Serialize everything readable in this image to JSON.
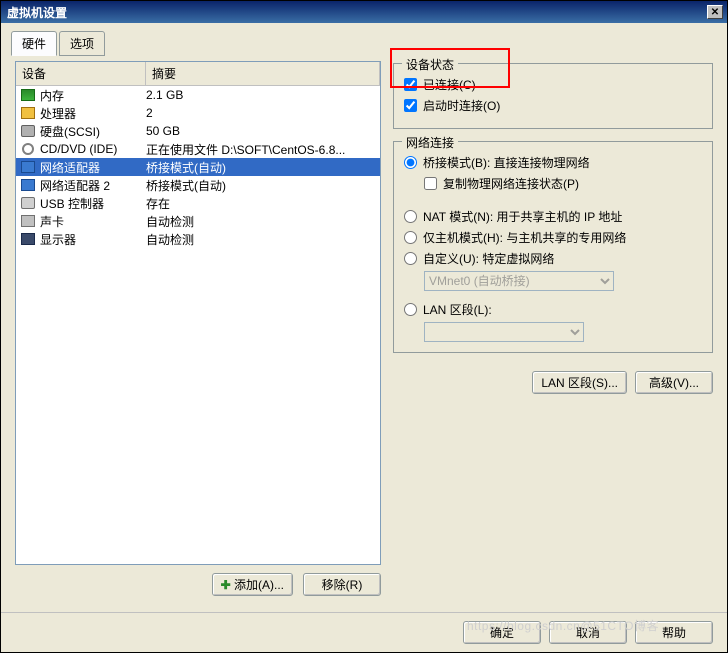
{
  "title": "虚拟机设置",
  "tabs": {
    "hardware": "硬件",
    "options": "选项"
  },
  "columns": {
    "device": "设备",
    "summary": "摘要"
  },
  "devices": [
    {
      "name": "内存",
      "summary": "2.1 GB",
      "icon": "mem"
    },
    {
      "name": "处理器",
      "summary": "2",
      "icon": "cpu"
    },
    {
      "name": "硬盘(SCSI)",
      "summary": "50 GB",
      "icon": "hdd"
    },
    {
      "name": "CD/DVD (IDE)",
      "summary": "正在使用文件 D:\\SOFT\\CentOS-6.8...",
      "icon": "cd"
    },
    {
      "name": "网络适配器",
      "summary": "桥接模式(自动)",
      "icon": "net",
      "selected": true
    },
    {
      "name": "网络适配器 2",
      "summary": "桥接模式(自动)",
      "icon": "net"
    },
    {
      "name": "USB 控制器",
      "summary": "存在",
      "icon": "usb"
    },
    {
      "name": "声卡",
      "summary": "自动检测",
      "icon": "snd"
    },
    {
      "name": "显示器",
      "summary": "自动检测",
      "icon": "dsp"
    }
  ],
  "leftButtons": {
    "add": "添加(A)...",
    "remove": "移除(R)"
  },
  "status": {
    "legend": "设备状态",
    "connected": "已连接(C)",
    "connectAtPowerOn": "启动时连接(O)"
  },
  "network": {
    "legend": "网络连接",
    "bridged": "桥接模式(B): 直接连接物理网络",
    "replicate": "复制物理网络连接状态(P)",
    "nat": "NAT 模式(N): 用于共享主机的 IP 地址",
    "hostOnly": "仅主机模式(H): 与主机共享的专用网络",
    "custom": "自定义(U): 特定虚拟网络",
    "vmnet": "VMnet0 (自动桥接)",
    "lan": "LAN 区段(L):"
  },
  "rightButtons": {
    "lanSegments": "LAN 区段(S)...",
    "advanced": "高级(V)..."
  },
  "footer": {
    "ok": "确定",
    "cancel": "取消",
    "help": "帮助"
  },
  "watermark": "https://blog.csdn.cn@51CTO博客"
}
